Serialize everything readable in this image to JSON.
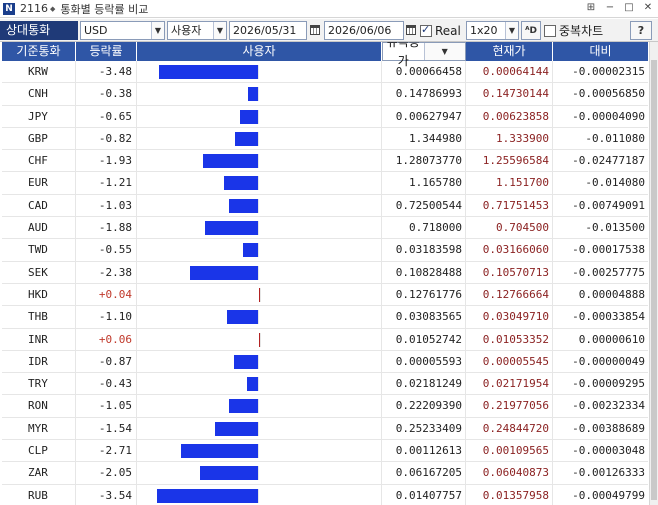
{
  "window": {
    "screen_no": "2116",
    "title": "통화별 등락률 비교"
  },
  "toolbar": {
    "label": "상대통화",
    "currency": "USD",
    "mode": "사용자",
    "date_from": "2026/05/31",
    "date_to": "2026/06/06",
    "real_label": "Real",
    "real_checked": true,
    "interval": "1x20",
    "overlap_label": "중복차트",
    "overlap_checked": false,
    "help_label": "?"
  },
  "table": {
    "headers": {
      "base": "기준통화",
      "rate": "등락률",
      "bar": "사용자",
      "ny": "뉴욕종가",
      "now": "현재가",
      "diff": "대비"
    },
    "bar_max_abs": 3.54,
    "rows": [
      {
        "cur": "KRW",
        "rate": "-3.48",
        "v": -3.48,
        "ny": "0.00066458",
        "now": "0.00064144",
        "diff": "-0.00002315"
      },
      {
        "cur": "CNH",
        "rate": "-0.38",
        "v": -0.38,
        "ny": "0.14786993",
        "now": "0.14730144",
        "diff": "-0.00056850"
      },
      {
        "cur": "JPY",
        "rate": "-0.65",
        "v": -0.65,
        "ny": "0.00627947",
        "now": "0.00623858",
        "diff": "-0.00004090"
      },
      {
        "cur": "GBP",
        "rate": "-0.82",
        "v": -0.82,
        "ny": "1.344980",
        "now": "1.333900",
        "diff": "-0.011080"
      },
      {
        "cur": "CHF",
        "rate": "-1.93",
        "v": -1.93,
        "ny": "1.28073770",
        "now": "1.25596584",
        "diff": "-0.02477187"
      },
      {
        "cur": "EUR",
        "rate": "-1.21",
        "v": -1.21,
        "ny": "1.165780",
        "now": "1.151700",
        "diff": "-0.014080"
      },
      {
        "cur": "CAD",
        "rate": "-1.03",
        "v": -1.03,
        "ny": "0.72500544",
        "now": "0.71751453",
        "diff": "-0.00749091"
      },
      {
        "cur": "AUD",
        "rate": "-1.88",
        "v": -1.88,
        "ny": "0.718000",
        "now": "0.704500",
        "diff": "-0.013500"
      },
      {
        "cur": "TWD",
        "rate": "-0.55",
        "v": -0.55,
        "ny": "0.03183598",
        "now": "0.03166060",
        "diff": "-0.00017538"
      },
      {
        "cur": "SEK",
        "rate": "-2.38",
        "v": -2.38,
        "ny": "0.10828488",
        "now": "0.10570713",
        "diff": "-0.00257775"
      },
      {
        "cur": "HKD",
        "rate": "+0.04",
        "v": 0.04,
        "ny": "0.12761776",
        "now": "0.12766664",
        "diff": "0.00004888"
      },
      {
        "cur": "THB",
        "rate": "-1.10",
        "v": -1.1,
        "ny": "0.03083565",
        "now": "0.03049710",
        "diff": "-0.00033854"
      },
      {
        "cur": "INR",
        "rate": "+0.06",
        "v": 0.06,
        "ny": "0.01052742",
        "now": "0.01053352",
        "diff": "0.00000610"
      },
      {
        "cur": "IDR",
        "rate": "-0.87",
        "v": -0.87,
        "ny": "0.00005593",
        "now": "0.00005545",
        "diff": "-0.00000049"
      },
      {
        "cur": "TRY",
        "rate": "-0.43",
        "v": -0.43,
        "ny": "0.02181249",
        "now": "0.02171954",
        "diff": "-0.00009295"
      },
      {
        "cur": "RON",
        "rate": "-1.05",
        "v": -1.05,
        "ny": "0.22209390",
        "now": "0.21977056",
        "diff": "-0.00232334"
      },
      {
        "cur": "MYR",
        "rate": "-1.54",
        "v": -1.54,
        "ny": "0.25233409",
        "now": "0.24844720",
        "diff": "-0.00388689"
      },
      {
        "cur": "CLP",
        "rate": "-2.71",
        "v": -2.71,
        "ny": "0.00112613",
        "now": "0.00109565",
        "diff": "-0.00003048"
      },
      {
        "cur": "ZAR",
        "rate": "-2.05",
        "v": -2.05,
        "ny": "0.06167205",
        "now": "0.06040873",
        "diff": "-0.00126333"
      },
      {
        "cur": "RUB",
        "rate": "-3.54",
        "v": -3.54,
        "ny": "0.01407757",
        "now": "0.01357958",
        "diff": "-0.00049799"
      }
    ]
  },
  "colors": {
    "negative_bar": "#1a35e8",
    "positive_bar": "#b22222",
    "header_bg": "#2f56a6",
    "label_bg": "#1f3a78"
  }
}
